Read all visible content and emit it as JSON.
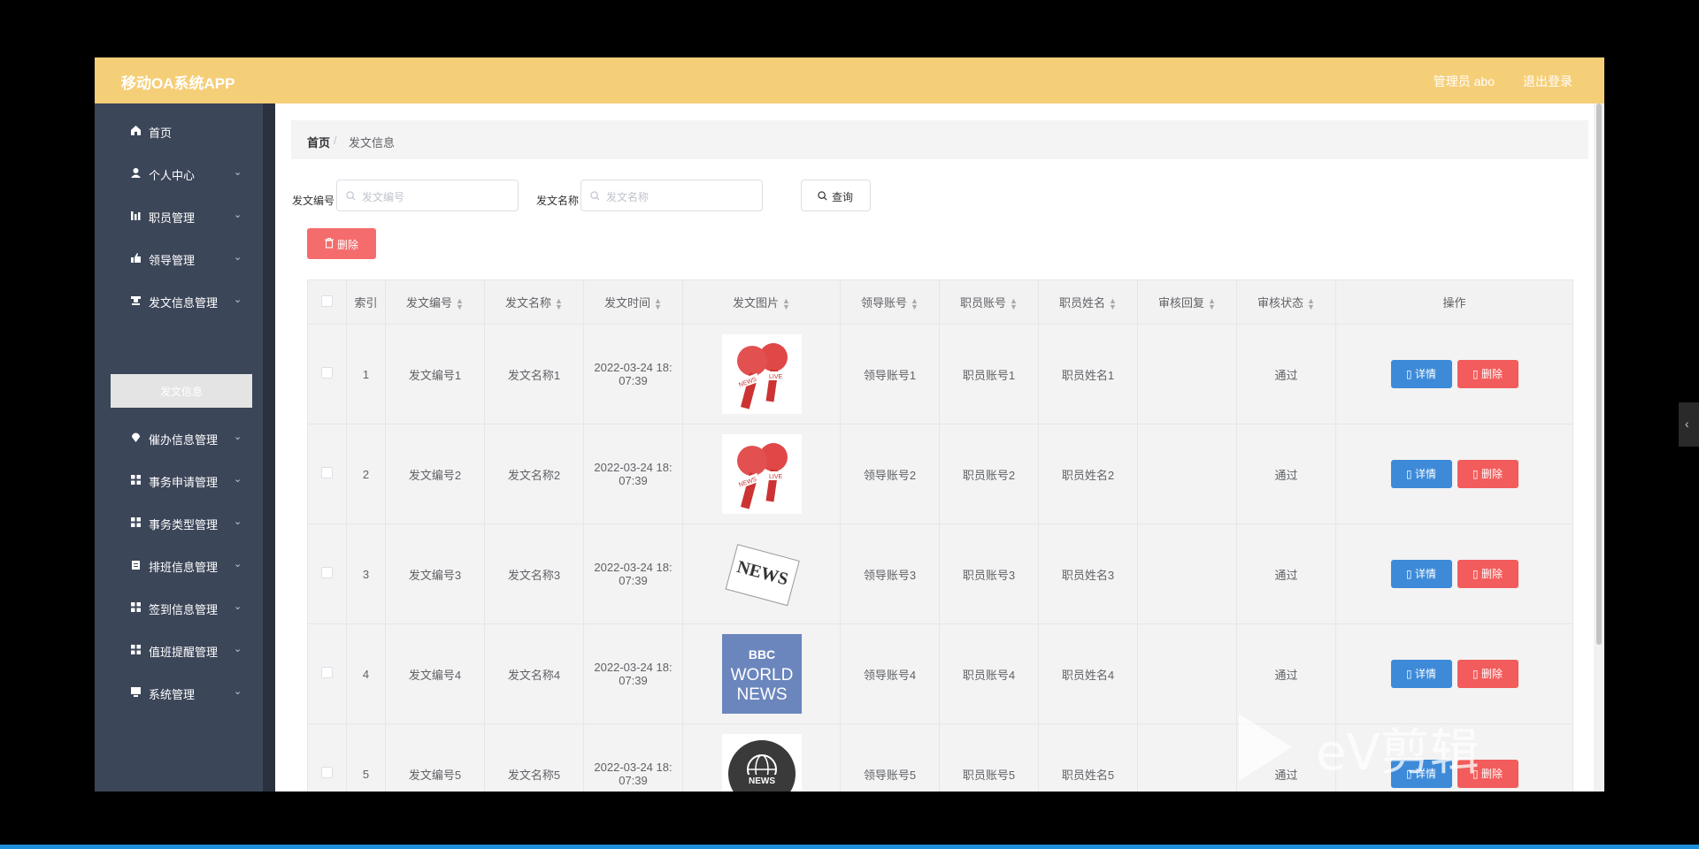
{
  "header": {
    "title": "移动OA系统APP",
    "user_label": "管理员 abo",
    "logout_label": "退出登录"
  },
  "sidebar": {
    "items": [
      {
        "label": "首页",
        "icon": "home-icon",
        "has_arrow": false
      },
      {
        "label": "个人中心",
        "icon": "user-icon",
        "has_arrow": true
      },
      {
        "label": "职员管理",
        "icon": "bar-chart-icon",
        "has_arrow": true
      },
      {
        "label": "领导管理",
        "icon": "thumb-up-icon",
        "has_arrow": true
      },
      {
        "label": "发文信息管理",
        "icon": "stamp-icon",
        "has_arrow": true
      },
      {
        "label": "催办信息管理",
        "icon": "location-icon",
        "has_arrow": true
      },
      {
        "label": "事务申请管理",
        "icon": "grid-icon",
        "has_arrow": true
      },
      {
        "label": "事务类型管理",
        "icon": "grid-icon",
        "has_arrow": true
      },
      {
        "label": "排班信息管理",
        "icon": "clipboard-icon",
        "has_arrow": true
      },
      {
        "label": "签到信息管理",
        "icon": "grid-icon",
        "has_arrow": true
      },
      {
        "label": "值班提醒管理",
        "icon": "grid-icon",
        "has_arrow": true
      },
      {
        "label": "系统管理",
        "icon": "monitor-icon",
        "has_arrow": true
      }
    ],
    "active_sub_item": "发文信息"
  },
  "breadcrumb": {
    "home": "首页",
    "separator": "/",
    "current": "发文信息"
  },
  "search": {
    "field1_label": "发文编号",
    "field1_placeholder": "发文编号",
    "field2_label": "发文名称",
    "field2_placeholder": "发文名称",
    "query_label": "查询"
  },
  "toolbar": {
    "delete_label": "删除"
  },
  "table": {
    "columns": [
      "索引",
      "发文编号",
      "发文名称",
      "发文时间",
      "发文图片",
      "领导账号",
      "职员账号",
      "职员姓名",
      "审核回复",
      "审核状态",
      "操作"
    ],
    "rows": [
      {
        "index": "1",
        "code": "发文编号1",
        "name": "发文名称1",
        "time_line1": "2022-03-24 18:",
        "time_line2": "07:39",
        "image": "live-news-microphones",
        "leader": "领导账号1",
        "staff_account": "职员账号1",
        "staff_name": "职员姓名1",
        "reply": "",
        "status": "通过",
        "detail": "详情",
        "delete": "删除"
      },
      {
        "index": "2",
        "code": "发文编号2",
        "name": "发文名称2",
        "time_line1": "2022-03-24 18:",
        "time_line2": "07:39",
        "image": "live-news-microphones",
        "leader": "领导账号2",
        "staff_account": "职员账号2",
        "staff_name": "职员姓名2",
        "reply": "",
        "status": "通过",
        "detail": "详情",
        "delete": "删除"
      },
      {
        "index": "3",
        "code": "发文编号3",
        "name": "发文名称3",
        "time_line1": "2022-03-24 18:",
        "time_line2": "07:39",
        "image": "newspaper",
        "leader": "领导账号3",
        "staff_account": "职员账号3",
        "staff_name": "职员姓名3",
        "reply": "",
        "status": "通过",
        "detail": "详情",
        "delete": "删除"
      },
      {
        "index": "4",
        "code": "发文编号4",
        "name": "发文名称4",
        "time_line1": "2022-03-24 18:",
        "time_line2": "07:39",
        "image": "bbc-world-news",
        "leader": "领导账号4",
        "staff_account": "职员账号4",
        "staff_name": "职员姓名4",
        "reply": "",
        "status": "通过",
        "detail": "详情",
        "delete": "删除"
      },
      {
        "index": "5",
        "code": "发文编号5",
        "name": "发文名称5",
        "time_line1": "2022-03-24 18:",
        "time_line2": "07:39",
        "image": "globe-news",
        "leader": "领导账号5",
        "staff_account": "职员账号5",
        "staff_name": "职员姓名5",
        "reply": "",
        "status": "通过",
        "detail": "详情",
        "delete": "删除"
      }
    ]
  },
  "thumb_text": {
    "news": "NEWS",
    "live": "LIVE",
    "bbc": "BBC",
    "world": "WORLD",
    "news2": "NEWS"
  },
  "watermark": "eV剪辑",
  "colors": {
    "header": "#f5ce78",
    "sidebar": "#3c4659",
    "delete": "#f56c6c",
    "detail": "#3d8ad8"
  }
}
